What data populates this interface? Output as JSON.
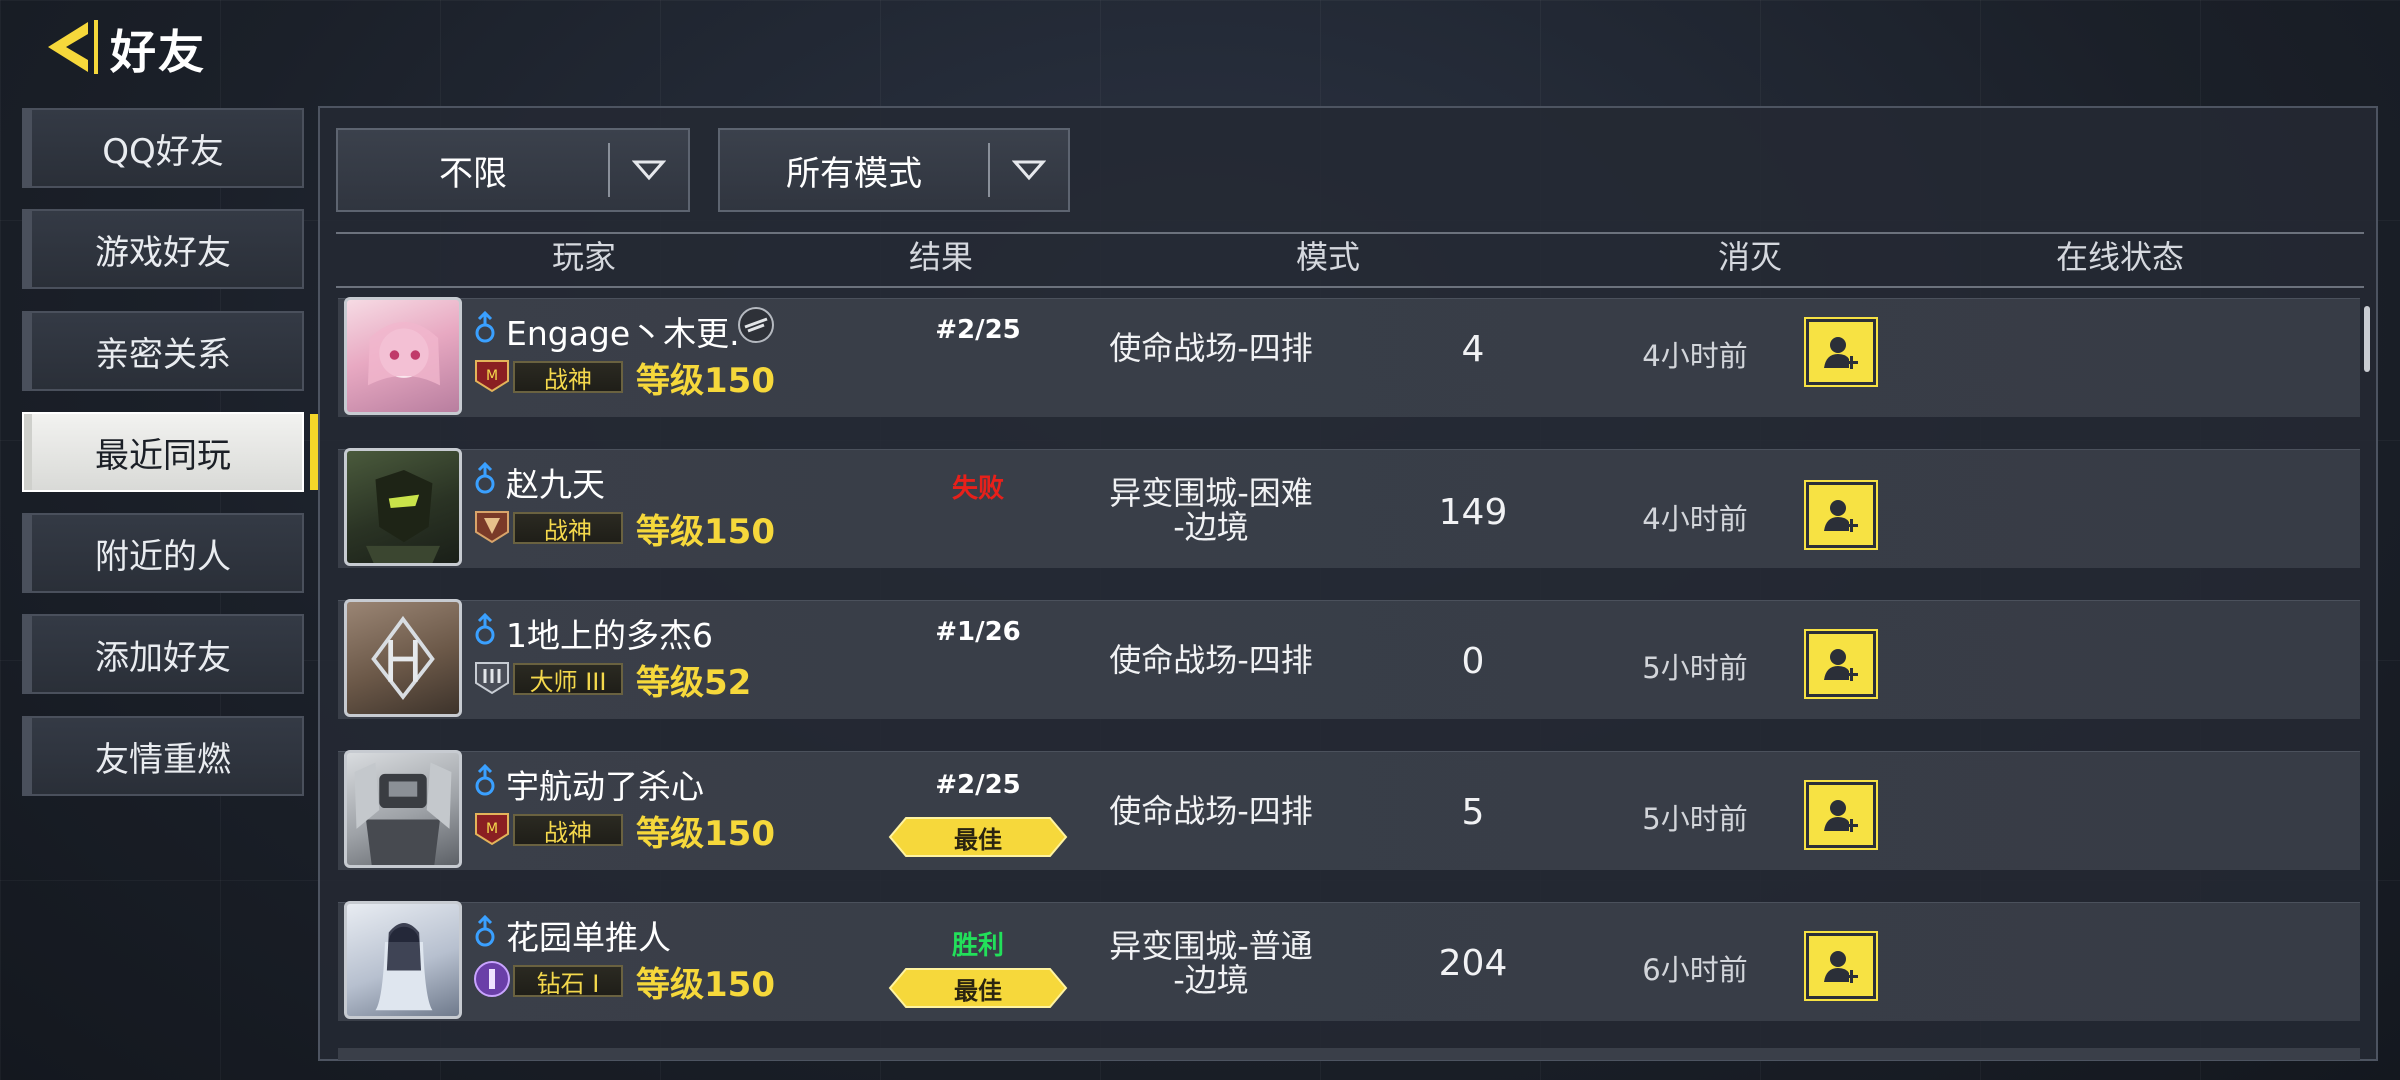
{
  "header": {
    "title": "好友"
  },
  "sidebar": {
    "items": [
      {
        "label": "QQ好友"
      },
      {
        "label": "游戏好友"
      },
      {
        "label": "亲密关系"
      },
      {
        "label": "最近同玩"
      },
      {
        "label": "附近的人"
      },
      {
        "label": "添加好友"
      },
      {
        "label": "友情重燃"
      }
    ],
    "active_index": 3
  },
  "filters": {
    "range": "不限",
    "mode": "所有模式"
  },
  "columns": {
    "player": "玩家",
    "result": "结果",
    "mode": "模式",
    "kills": "消灭",
    "status": "在线状态"
  },
  "colors": {
    "accent": "#f6d83b",
    "win": "#22e05a",
    "loss": "#e8201a",
    "gender": "#3aa0ff"
  },
  "rows": [
    {
      "name": "Engage丶木更.",
      "rank": "战神",
      "level": "等级150",
      "result": "#2/25",
      "mvp": "",
      "mode_line1": "使命战场-四排",
      "mode_line2": "",
      "kills": "4",
      "status": "4小时前"
    },
    {
      "name": "赵九天",
      "rank": "战神",
      "level": "等级150",
      "result": "失败",
      "mvp": "",
      "mode_line1": "异变围城-困难",
      "mode_line2": "-边境",
      "kills": "149",
      "status": "4小时前"
    },
    {
      "name": "1地上的多杰6",
      "rank": "大师 III",
      "level": "等级52",
      "result": "#1/26",
      "mvp": "",
      "mode_line1": "使命战场-四排",
      "mode_line2": "",
      "kills": "0",
      "status": "5小时前"
    },
    {
      "name": "宇航动了杀心",
      "rank": "战神",
      "level": "等级150",
      "result": "#2/25",
      "mvp": "最佳",
      "mode_line1": "使命战场-四排",
      "mode_line2": "",
      "kills": "5",
      "status": "5小时前"
    },
    {
      "name": "花园单推人",
      "rank": "钻石 I",
      "level": "等级150",
      "result": "胜利",
      "mvp": "最佳",
      "mode_line1": "异变围城-普通",
      "mode_line2": "-边境",
      "kills": "204",
      "status": "6小时前"
    }
  ]
}
